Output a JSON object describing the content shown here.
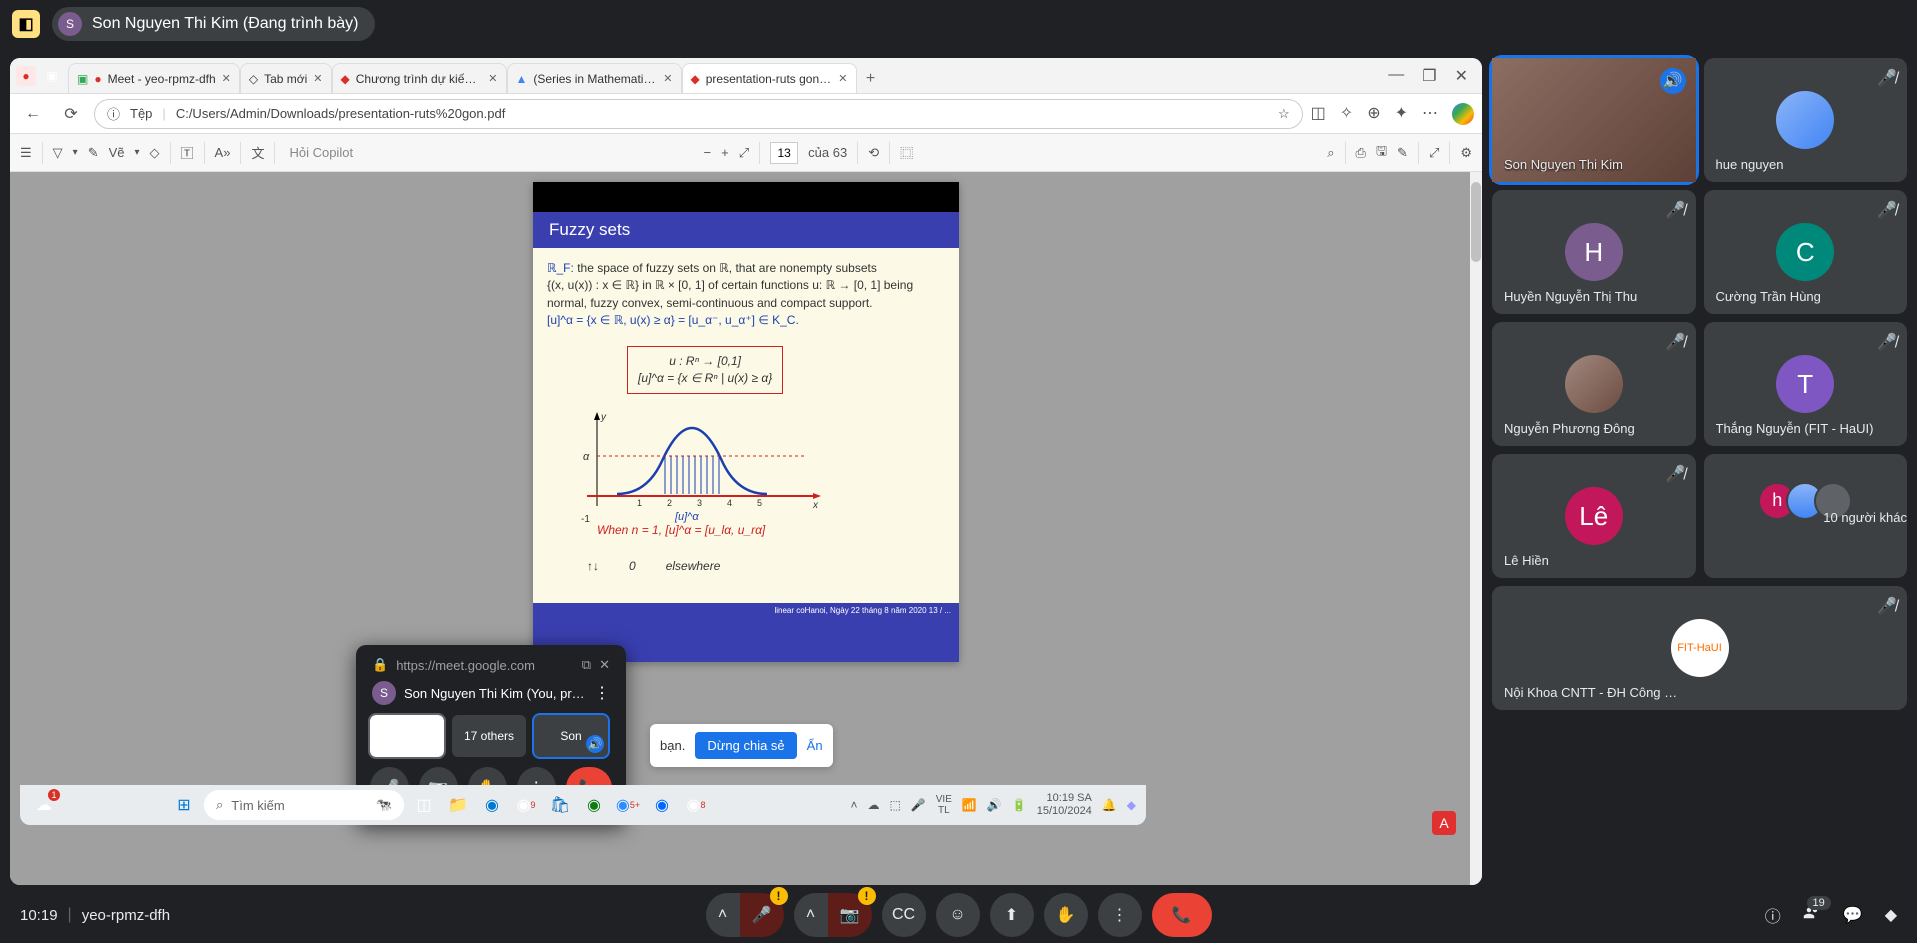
{
  "meet": {
    "presenter_initial": "S",
    "presenter_name": "Son Nguyen Thi Kim (Đang trình bày)",
    "time": "10:19",
    "code": "yeo-rpmz-dfh",
    "people_count": "19",
    "pip": {
      "url": "https://meet.google.com",
      "you_label": "Son Nguyen Thi Kim (You, presenti...",
      "others_label": "17 others",
      "son_label": "Son"
    },
    "share_overlay": {
      "text": "bạn.",
      "stop_btn": "Dừng chia sẻ",
      "hide_btn": "Ẩn"
    }
  },
  "participants": [
    {
      "name": "Son Nguyen Thi Kim",
      "type": "video",
      "speaking": true
    },
    {
      "name": "hue nguyen",
      "type": "img",
      "muted": true
    },
    {
      "name": "Huyền Nguyễn Thị Thu",
      "initial": "H",
      "color": "#7b5c8f",
      "muted": true
    },
    {
      "name": "Cường Trần Hùng",
      "initial": "C",
      "color": "#00897b",
      "muted": true
    },
    {
      "name": "Nguyễn Phương Đông",
      "type": "img",
      "muted": true
    },
    {
      "name": "Thắng Nguyễn (FIT - HaUI)",
      "initial": "T",
      "color": "#7e57c2",
      "muted": true
    },
    {
      "name": "Lê Hiền",
      "initial": "Lê",
      "color": "#c2185b",
      "muted": true
    },
    {
      "name": "10 người khác",
      "type": "multi",
      "muted": false
    },
    {
      "name": "Nội Khoa CNTT - ĐH Công ng...",
      "type": "logo",
      "muted": true
    }
  ],
  "browser": {
    "tabs": [
      {
        "label": "Meet - yeo-rpmz-dfh",
        "icon": "meet"
      },
      {
        "label": "Tab mới",
        "icon": "edge"
      },
      {
        "label": "Chương trình dự kiến Hội...",
        "icon": "pdf"
      },
      {
        "label": "(Series in Mathematical A...",
        "icon": "drive"
      },
      {
        "label": "presentation-ruts gon.pd...",
        "icon": "pdf",
        "active": true
      }
    ],
    "url_label": "Tệp",
    "url": "C:/Users/Admin/Downloads/presentation-ruts%20gon.pdf"
  },
  "pdf": {
    "draw_label": "Vẽ",
    "copilot_placeholder": "Hỏi Copilot",
    "page": "13",
    "page_of": "của 63"
  },
  "slide": {
    "title": "Fuzzy sets",
    "line1a": "ℝ_F: ",
    "line1b": "the space of fuzzy sets on ℝ, that are nonempty subsets",
    "line2": "{(x, u(x)) : x ∈ ℝ} in ℝ × [0, 1] of certain functions u: ℝ → [0, 1] being",
    "line3": "normal, fuzzy convex, semi-continuous and compact support.",
    "line4": "[u]^α = {x ∈ ℝ, u(x) ≥ α} = [u_α⁻, u_α⁺] ∈ K_C.",
    "formula1": "u : Rⁿ → [0,1]",
    "formula2": "[u]^α = {x ∈ Rⁿ | u(x) ≥ α}",
    "when": "When n = 1, [u]^α = [u_lα, u_rα]",
    "elsewhere": "elsewhere",
    "zero": "0",
    "footer": "linear coHanoi, Ngày 22 tháng 8 năm 2020    13 / ...",
    "axis_alpha": "α",
    "axis_y": "y",
    "axis_x": "x",
    "axis_neg1": "-1",
    "ticks": [
      "1",
      "2",
      "3",
      "4",
      "5"
    ],
    "u_alpha": "[u]^α"
  },
  "taskbar": {
    "search_placeholder": "Tìm kiếm",
    "lang1": "VIE",
    "lang2": "TL",
    "time1": "10:19 SA",
    "time2": "15/10/2024"
  }
}
